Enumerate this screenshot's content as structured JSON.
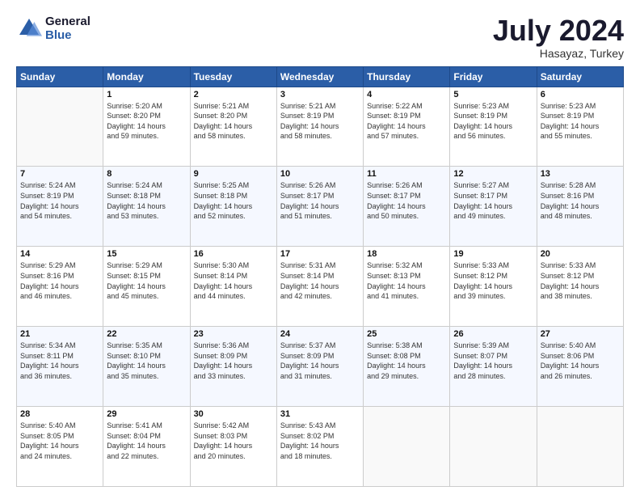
{
  "logo": {
    "line1": "General",
    "line2": "Blue"
  },
  "title": "July 2024",
  "subtitle": "Hasayaz, Turkey",
  "header_days": [
    "Sunday",
    "Monday",
    "Tuesday",
    "Wednesday",
    "Thursday",
    "Friday",
    "Saturday"
  ],
  "weeks": [
    [
      {
        "day": "",
        "info": ""
      },
      {
        "day": "1",
        "info": "Sunrise: 5:20 AM\nSunset: 8:20 PM\nDaylight: 14 hours\nand 59 minutes."
      },
      {
        "day": "2",
        "info": "Sunrise: 5:21 AM\nSunset: 8:20 PM\nDaylight: 14 hours\nand 58 minutes."
      },
      {
        "day": "3",
        "info": "Sunrise: 5:21 AM\nSunset: 8:19 PM\nDaylight: 14 hours\nand 58 minutes."
      },
      {
        "day": "4",
        "info": "Sunrise: 5:22 AM\nSunset: 8:19 PM\nDaylight: 14 hours\nand 57 minutes."
      },
      {
        "day": "5",
        "info": "Sunrise: 5:23 AM\nSunset: 8:19 PM\nDaylight: 14 hours\nand 56 minutes."
      },
      {
        "day": "6",
        "info": "Sunrise: 5:23 AM\nSunset: 8:19 PM\nDaylight: 14 hours\nand 55 minutes."
      }
    ],
    [
      {
        "day": "7",
        "info": "Sunrise: 5:24 AM\nSunset: 8:19 PM\nDaylight: 14 hours\nand 54 minutes."
      },
      {
        "day": "8",
        "info": "Sunrise: 5:24 AM\nSunset: 8:18 PM\nDaylight: 14 hours\nand 53 minutes."
      },
      {
        "day": "9",
        "info": "Sunrise: 5:25 AM\nSunset: 8:18 PM\nDaylight: 14 hours\nand 52 minutes."
      },
      {
        "day": "10",
        "info": "Sunrise: 5:26 AM\nSunset: 8:17 PM\nDaylight: 14 hours\nand 51 minutes."
      },
      {
        "day": "11",
        "info": "Sunrise: 5:26 AM\nSunset: 8:17 PM\nDaylight: 14 hours\nand 50 minutes."
      },
      {
        "day": "12",
        "info": "Sunrise: 5:27 AM\nSunset: 8:17 PM\nDaylight: 14 hours\nand 49 minutes."
      },
      {
        "day": "13",
        "info": "Sunrise: 5:28 AM\nSunset: 8:16 PM\nDaylight: 14 hours\nand 48 minutes."
      }
    ],
    [
      {
        "day": "14",
        "info": "Sunrise: 5:29 AM\nSunset: 8:16 PM\nDaylight: 14 hours\nand 46 minutes."
      },
      {
        "day": "15",
        "info": "Sunrise: 5:29 AM\nSunset: 8:15 PM\nDaylight: 14 hours\nand 45 minutes."
      },
      {
        "day": "16",
        "info": "Sunrise: 5:30 AM\nSunset: 8:14 PM\nDaylight: 14 hours\nand 44 minutes."
      },
      {
        "day": "17",
        "info": "Sunrise: 5:31 AM\nSunset: 8:14 PM\nDaylight: 14 hours\nand 42 minutes."
      },
      {
        "day": "18",
        "info": "Sunrise: 5:32 AM\nSunset: 8:13 PM\nDaylight: 14 hours\nand 41 minutes."
      },
      {
        "day": "19",
        "info": "Sunrise: 5:33 AM\nSunset: 8:12 PM\nDaylight: 14 hours\nand 39 minutes."
      },
      {
        "day": "20",
        "info": "Sunrise: 5:33 AM\nSunset: 8:12 PM\nDaylight: 14 hours\nand 38 minutes."
      }
    ],
    [
      {
        "day": "21",
        "info": "Sunrise: 5:34 AM\nSunset: 8:11 PM\nDaylight: 14 hours\nand 36 minutes."
      },
      {
        "day": "22",
        "info": "Sunrise: 5:35 AM\nSunset: 8:10 PM\nDaylight: 14 hours\nand 35 minutes."
      },
      {
        "day": "23",
        "info": "Sunrise: 5:36 AM\nSunset: 8:09 PM\nDaylight: 14 hours\nand 33 minutes."
      },
      {
        "day": "24",
        "info": "Sunrise: 5:37 AM\nSunset: 8:09 PM\nDaylight: 14 hours\nand 31 minutes."
      },
      {
        "day": "25",
        "info": "Sunrise: 5:38 AM\nSunset: 8:08 PM\nDaylight: 14 hours\nand 29 minutes."
      },
      {
        "day": "26",
        "info": "Sunrise: 5:39 AM\nSunset: 8:07 PM\nDaylight: 14 hours\nand 28 minutes."
      },
      {
        "day": "27",
        "info": "Sunrise: 5:40 AM\nSunset: 8:06 PM\nDaylight: 14 hours\nand 26 minutes."
      }
    ],
    [
      {
        "day": "28",
        "info": "Sunrise: 5:40 AM\nSunset: 8:05 PM\nDaylight: 14 hours\nand 24 minutes."
      },
      {
        "day": "29",
        "info": "Sunrise: 5:41 AM\nSunset: 8:04 PM\nDaylight: 14 hours\nand 22 minutes."
      },
      {
        "day": "30",
        "info": "Sunrise: 5:42 AM\nSunset: 8:03 PM\nDaylight: 14 hours\nand 20 minutes."
      },
      {
        "day": "31",
        "info": "Sunrise: 5:43 AM\nSunset: 8:02 PM\nDaylight: 14 hours\nand 18 minutes."
      },
      {
        "day": "",
        "info": ""
      },
      {
        "day": "",
        "info": ""
      },
      {
        "day": "",
        "info": ""
      }
    ]
  ]
}
